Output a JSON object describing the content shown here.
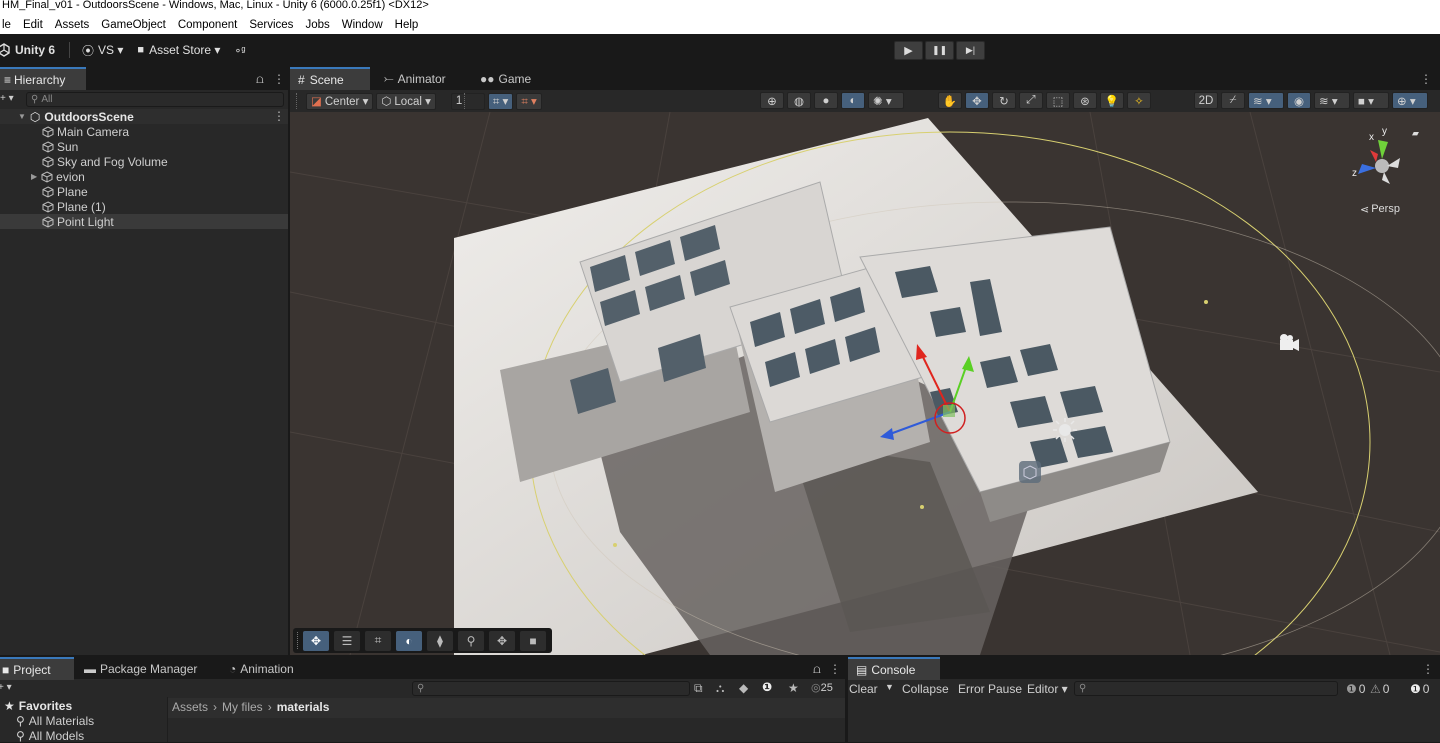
{
  "window": {
    "title": "HM_Final_v01 - OutdoorsScene - Windows, Mac, Linux - Unity 6 (6000.0.25f1) <DX12>"
  },
  "menu": [
    "le",
    "Edit",
    "Assets",
    "GameObject",
    "Component",
    "Services",
    "Jobs",
    "Window",
    "Help"
  ],
  "toolbar": {
    "unity_label": "Unity 6",
    "vs_label": "VS ▾",
    "asset_store_label": "Asset Store ▾",
    "play_icon": "▶",
    "pause_icon": "❚❚",
    "step_icon": "▶|"
  },
  "hierarchy": {
    "tab_label": "Hierarchy",
    "search_placeholder": "All",
    "scene_name": "OutdoorsScene",
    "items": [
      "Main Camera",
      "Sun",
      "Sky and Fog Volume",
      "evion",
      "Plane",
      "Plane (1)",
      "Point Light"
    ],
    "selected_index": 6
  },
  "scene_tabs": {
    "scene": "Scene",
    "animator": "Animator",
    "game": "Game"
  },
  "scene_toolbar": {
    "pivot": "Center ▾",
    "space": "Local ▾",
    "grid_value": "1"
  },
  "gizmo": {
    "persp_label": "Persp",
    "axis_x": "x",
    "axis_y": "y",
    "axis_z": "z"
  },
  "project": {
    "tab_project": "Project",
    "tab_package_manager": "Package Manager",
    "tab_animation": "Animation",
    "favorites_label": "Favorites",
    "favorites": [
      "All Materials",
      "All Models"
    ],
    "breadcrumb_assets": "Assets",
    "breadcrumb_myfiles": "My files",
    "breadcrumb_current": "materials",
    "hidden_count": "25"
  },
  "console": {
    "tab_label": "Console",
    "clear": "Clear",
    "collapse": "Collapse",
    "error_pause": "Error Pause",
    "editor": "Editor ▾",
    "info_count": "0",
    "warn_count": "0",
    "error_count": "0"
  },
  "colors": {
    "selected": "#2c5d87",
    "accent": "#3a79bb",
    "scene_bg": "#3a3431",
    "ground": "#d7d3cf"
  }
}
